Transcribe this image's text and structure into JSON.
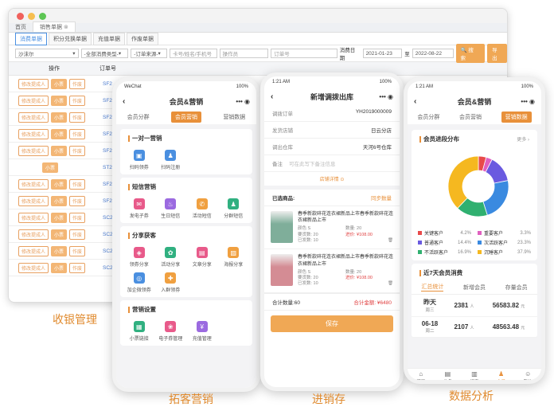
{
  "desktop": {
    "tabs_top": [
      "首页",
      "销售单据"
    ],
    "tabs_sub": [
      "消费单据",
      "积分兑换单据",
      "充值单据",
      "作废单据"
    ],
    "filters": {
      "store": "沙沫尔",
      "consume_type": "-全部消费类型-",
      "order_source": "-订单来源-",
      "card_placeholder": "卡号/姓名/手机号",
      "operator_placeholder": "操作员",
      "order_placeholder": "订单号",
      "date_label": "消费日期",
      "date_from": "2021-01-23",
      "date_to_label": "至",
      "date_to": "2022-08-22",
      "search_btn": "搜 索",
      "export_btn": "导出"
    },
    "table_head": {
      "op": "操作",
      "order": "订单号"
    },
    "rows": [
      {
        "tags": [
          "修改提成人",
          "小票",
          "作废"
        ],
        "code": "SF2"
      },
      {
        "tags": [
          "修改提成人",
          "小票",
          "作废"
        ],
        "code": "SF2"
      },
      {
        "tags": [
          "修改提成人",
          "小票",
          "作废"
        ],
        "code": "SF2"
      },
      {
        "tags": [
          "修改提成人",
          "小票",
          "作废"
        ],
        "code": "SF2"
      },
      {
        "tags": [
          "修改提成人",
          "小票",
          "作废"
        ],
        "code": "SF2"
      },
      {
        "tags": [
          "小票"
        ],
        "code": "ST2"
      },
      {
        "tags": [
          "修改提成人",
          "小票",
          "作废"
        ],
        "code": "SF2"
      },
      {
        "tags": [
          "修改提成人",
          "小票",
          "作废"
        ],
        "code": "SF2"
      },
      {
        "tags": [
          "修改提成人",
          "小票",
          "作废"
        ],
        "code": "SC2"
      },
      {
        "tags": [
          "修改提成人",
          "小票",
          "作废"
        ],
        "code": "SC2"
      },
      {
        "tags": [
          "修改提成人",
          "小票",
          "作废"
        ],
        "code": "SC2"
      },
      {
        "tags": [
          "修改提成人",
          "小票",
          "作废"
        ],
        "code": "SC2"
      }
    ],
    "caption": "收银管理"
  },
  "phone1": {
    "status_left": "WeChat",
    "status_right": "100%",
    "title": "会员&营销",
    "segments": [
      "会员分群",
      "会员营销",
      "营销数据"
    ],
    "sections": [
      {
        "title": "一对一营销",
        "items": [
          {
            "label": "扫码领券",
            "icon": "coupon-icon",
            "color": "#4a8fe0"
          },
          {
            "label": "扫码注册",
            "icon": "user-add-icon",
            "color": "#4a8fe0"
          }
        ]
      },
      {
        "title": "短信营销",
        "items": [
          {
            "label": "发电子券",
            "icon": "ticket-icon",
            "color": "#e85a8a"
          },
          {
            "label": "生日短信",
            "icon": "cake-icon",
            "color": "#9b6ae0"
          },
          {
            "label": "活动短信",
            "icon": "megaphone-icon",
            "color": "#f0a040"
          },
          {
            "label": "分群短信",
            "icon": "group-icon",
            "color": "#30b080"
          }
        ]
      },
      {
        "title": "分享获客",
        "items": [
          {
            "label": "领券分享",
            "icon": "share-coupon-icon",
            "color": "#e85a8a"
          },
          {
            "label": "活动分享",
            "icon": "share-activity-icon",
            "color": "#30b080"
          },
          {
            "label": "文章分享",
            "icon": "article-icon",
            "color": "#e85a8a"
          },
          {
            "label": "海报分享",
            "icon": "poster-icon",
            "color": "#f0a040"
          },
          {
            "label": "加企微领券",
            "icon": "wecom-icon",
            "color": "#4a8fe0"
          },
          {
            "label": "入群领券",
            "icon": "group-join-icon",
            "color": "#f0a040"
          }
        ]
      },
      {
        "title": "营销设置",
        "items": [
          {
            "label": "小票链接",
            "icon": "receipt-icon",
            "color": "#30b080"
          },
          {
            "label": "电子券管理",
            "icon": "coupon-manage-icon",
            "color": "#e85a8a"
          },
          {
            "label": "充值管理",
            "icon": "recharge-icon",
            "color": "#9b6ae0"
          }
        ]
      }
    ],
    "caption": "拓客营销"
  },
  "phone2": {
    "status_left": "1:21 AM",
    "status_right": "100%",
    "title": "新增调拨出库",
    "fields": [
      {
        "k": "调拨订单",
        "v": "YH2019000009"
      },
      {
        "k": "发货店铺",
        "v": "日云分店"
      },
      {
        "k": "调出仓库",
        "v": "天河6号仓库"
      }
    ],
    "remark_label": "备注",
    "remark_placeholder": "可在此写下备注信息",
    "scan_label": "店铺详情",
    "list_title": "已选商品:",
    "sync_label": "同步数量",
    "products": [
      {
        "name": "春季新款碎花连衣裙新品上市春季新款碎花连衣裙新品上市",
        "color": "颜色 S",
        "qty": "数量: 20",
        "want": "要货数: 20",
        "price": "进价: ¥108.00",
        "arrived": "已发数: 10"
      },
      {
        "name": "春季新款碎花连衣裙新品上市春季新款碎花连衣裙新品上市",
        "color": "颜色 S",
        "qty": "数量: 20",
        "want": "要货数: 20",
        "price": "进价: ¥108.00",
        "arrived": "已发数: 10"
      }
    ],
    "total_qty": "合计数量:60",
    "total_amount": "合计金额: ¥6480",
    "save_btn": "保存",
    "caption": "进销存"
  },
  "phone3": {
    "status_left": "1:21 AM",
    "status_right": "100%",
    "title": "会员&营销",
    "segments": [
      "会员分群",
      "会员营销",
      "营销数据"
    ],
    "dist_title": "会员进段分布",
    "more": "更多",
    "chart_data": {
      "type": "pie",
      "title": "会员进段分布",
      "categories": [
        "关键客户",
        "重要客户",
        "普通客户",
        "次活跃客户",
        "不活跃客户",
        "沉睡客户"
      ],
      "values": [
        4.2,
        3.3,
        14.4,
        23.3,
        16.9,
        37.9
      ],
      "colors": [
        "#e84a4a",
        "#e060c0",
        "#6a5ae0",
        "#3a8ae0",
        "#30b070",
        "#f5b820"
      ]
    },
    "legend_pct": [
      "4.2%",
      "3.3%",
      "14.4%",
      "23.3%",
      "16.9%",
      "37.9%"
    ],
    "consume_title": "近7天会员消费",
    "consume_tabs": [
      "汇总统计",
      "新增会员",
      "存量会员"
    ],
    "consume_rows": [
      {
        "day": "昨天",
        "sub": "周三",
        "count": "2381",
        "unit": "人",
        "amount": "56583.82",
        "aunit": "元"
      },
      {
        "day": "06-18",
        "sub": "周二",
        "count": "2107",
        "unit": "人",
        "amount": "48563.48",
        "aunit": "元"
      }
    ],
    "tabbar": [
      "首页",
      "业务",
      "报表",
      "会员",
      "我的"
    ],
    "caption": "数据分析"
  }
}
